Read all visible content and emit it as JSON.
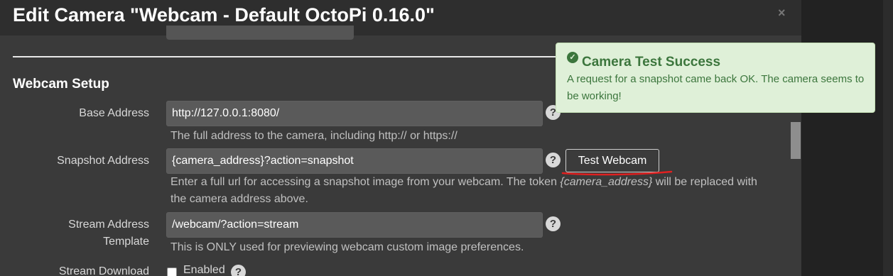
{
  "modal": {
    "title": "Edit Camera \"Webcam - Default OctoPi 0.16.0\"",
    "close_symbol": "×"
  },
  "webcam_setup": {
    "section_title": "Webcam Setup",
    "base_address": {
      "label": "Base Address",
      "value": "http://127.0.0.1:8080/",
      "help": "The full address to the camera, including http:// or https://"
    },
    "snapshot_address": {
      "label": "Snapshot Address",
      "value": "{camera_address}?action=snapshot",
      "help_before": "Enter a full url for accessing a snapshot image from your webcam. The token ",
      "help_token": "{camera_address}",
      "help_after": " will be replaced with the camera address above.",
      "test_button": "Test Webcam"
    },
    "stream_template": {
      "label_line1": "Stream Address",
      "label_line2": "Template",
      "value": "/webcam/?action=stream",
      "help": "This is ONLY used for previewing webcam custom image preferences."
    },
    "stream_download": {
      "label": "Stream Download",
      "checkbox_label": "Enabled"
    },
    "help_icon_symbol": "?"
  },
  "toast": {
    "title": "Camera Test Success",
    "message": "A request for a snapshot came back OK. The camera seems to be working!",
    "color": "#3c763d",
    "background": "#dff0d8"
  },
  "icons": {
    "help": "question-circle-icon",
    "success": "check-circle-icon",
    "close": "close-icon"
  }
}
